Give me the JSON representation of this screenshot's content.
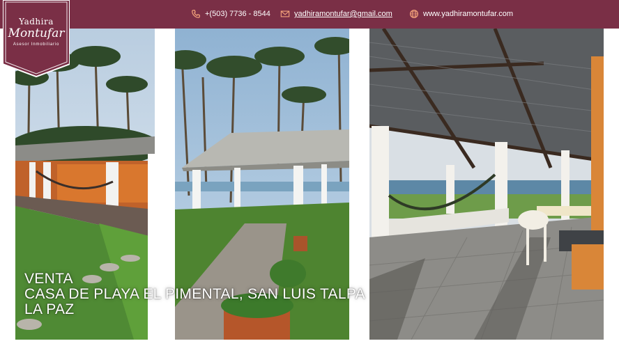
{
  "header": {
    "phone": "+(503) 7736 - 8544",
    "email": "yadhiramontufar@gmail.com",
    "website": "www.yadhiramontufar.com",
    "background_color": "#7a2f46"
  },
  "logo": {
    "name": "Yadhira",
    "surname": "Montufar",
    "tagline": "Asesor Inmobiliario",
    "badge_color": "#7a2f46"
  },
  "icons": {
    "phone": "phone-icon",
    "email": "envelope-icon",
    "website": "globe-icon"
  },
  "caption": {
    "line1": "VENTA",
    "line2": "CASA DE PLAYA EL PIMENTAL, SAN LUIS TALPA",
    "line3": "LA PAZ"
  },
  "photos": [
    {
      "subject": "garden-with-palms-and-gazebo"
    },
    {
      "subject": "gazebo-with-ocean-view"
    },
    {
      "subject": "covered-terrace-with-hammock"
    }
  ]
}
